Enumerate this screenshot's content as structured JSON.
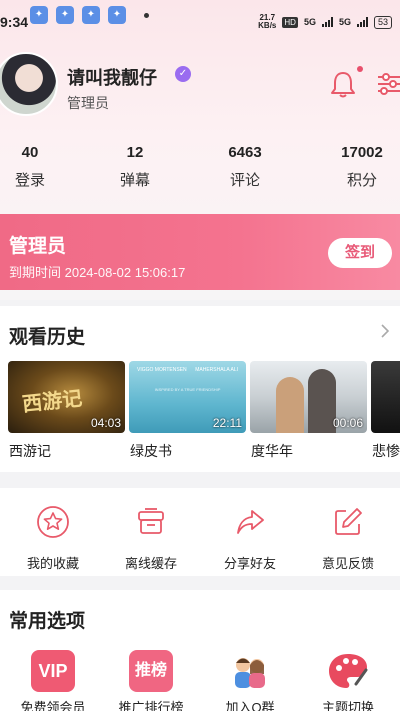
{
  "status_bar": {
    "time": "9:34",
    "speed_value": "21.7",
    "speed_unit": "KB/s",
    "hd": "HD",
    "signal1": "5G",
    "signal2": "5G",
    "battery": "53"
  },
  "profile": {
    "username": "请叫我靓仔",
    "role": "管理员"
  },
  "stats": [
    {
      "value": "40",
      "label": "登录"
    },
    {
      "value": "12",
      "label": "弹幕"
    },
    {
      "value": "6463",
      "label": "评论"
    },
    {
      "value": "17002",
      "label": "积分"
    }
  ],
  "membership": {
    "title": "管理员",
    "expire": "到期时间 2024-08-02 15:06:17",
    "checkin_label": "签到"
  },
  "history": {
    "title": "观看历史",
    "items": [
      {
        "title": "西游记",
        "duration": "04:03",
        "thumb_text": "西游记"
      },
      {
        "title": "绿皮书",
        "duration": "22:11",
        "thumb_left": "VIGGO MORTENSEN",
        "thumb_right": "MAHERSHALA ALI",
        "thumb_mid": "INSPIRED BY A TRUE FRIENDSHIP"
      },
      {
        "title": "度华年",
        "duration": "00:06"
      },
      {
        "title": "悲惨"
      }
    ]
  },
  "actions": [
    {
      "label": "我的收藏",
      "icon": "star-circle-icon"
    },
    {
      "label": "离线缓存",
      "icon": "download-box-icon"
    },
    {
      "label": "分享好友",
      "icon": "share-arrow-icon"
    },
    {
      "label": "意见反馈",
      "icon": "edit-note-icon"
    }
  ],
  "options": {
    "title": "常用选项",
    "items": [
      {
        "label": "免费领会员",
        "box_text": "VIP",
        "color": "#ef5a73"
      },
      {
        "label": "推广排行榜",
        "box_text": "推榜",
        "color": "#f06682"
      },
      {
        "label": "加入Q群",
        "icon": "group-people-icon"
      },
      {
        "label": "主题切换",
        "icon": "palette-icon",
        "color": "#e84a5f"
      }
    ]
  },
  "colors": {
    "accent": "#f06a86",
    "icon_red": "#e85a6a"
  }
}
